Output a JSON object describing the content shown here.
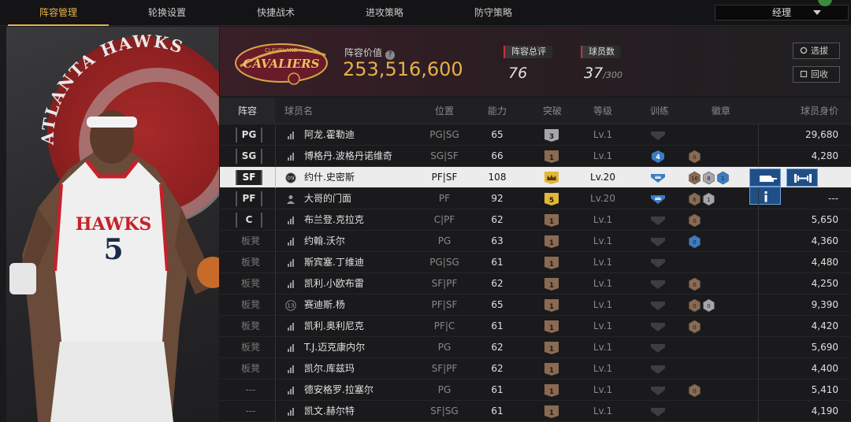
{
  "nav": {
    "tabs": [
      "阵容管理",
      "轮换设置",
      "快捷战术",
      "进攻策略",
      "防守策略"
    ],
    "active_tab": 0,
    "role_select": "经理"
  },
  "poster": {
    "team_word": "ATLANTA HAWKS",
    "jersey_text": "HAWKS",
    "jersey_number": "5"
  },
  "header": {
    "team_logo_text": "CAVALIERS",
    "team_logo_subtext": "CLEVELAND",
    "value_label": "阵容价值",
    "value": "253,516,600",
    "rating_label": "阵容总评",
    "rating": "76",
    "players_label": "球员数",
    "players": "37",
    "players_max": "/300",
    "btn_select": "选拔",
    "btn_recycle": "回收"
  },
  "columns": {
    "lineup": "阵容",
    "name": "球员名",
    "position": "位置",
    "ability": "能力",
    "breakthrough": "突破",
    "level": "等级",
    "training": "训练",
    "badges": "徽章",
    "price": "球员身价"
  },
  "rows": [
    {
      "slot": "PG",
      "slot_type": "starter",
      "name_icon": "bars",
      "name": "阿龙.霍勒迪",
      "position": "PG|SG",
      "ability": "65",
      "breakthrough": "3",
      "breakthrough_type": "silver",
      "level": "Lv.1",
      "training": "none",
      "badges": [],
      "price": "29,680"
    },
    {
      "slot": "SG",
      "slot_type": "starter",
      "name_icon": "bars",
      "name": "博格丹.波格丹诺维奇",
      "position": "SG|SF",
      "ability": "66",
      "breakthrough": "1",
      "breakthrough_type": "bronze",
      "level": "Lv.1",
      "training": "4",
      "badges": [
        {
          "t": "bronze",
          "v": "0"
        }
      ],
      "price": "4,280"
    },
    {
      "slot": "SF",
      "slot_type": "starter",
      "name_icon": "09",
      "name": "约什.史密斯",
      "position": "PF|SF",
      "ability": "108",
      "breakthrough": "crown",
      "breakthrough_type": "gold",
      "level": "Lv.20",
      "training": "crown",
      "badges": [
        {
          "t": "bronze",
          "v": "16"
        },
        {
          "t": "silver",
          "v": "8"
        },
        {
          "t": "blue",
          "v": "1"
        }
      ],
      "price": "",
      "selected": true
    },
    {
      "slot": "PF",
      "slot_type": "starter",
      "name_icon": "person",
      "name": "大哥的门面",
      "position": "PF",
      "ability": "92",
      "breakthrough": "5",
      "breakthrough_type": "gold",
      "level": "Lv.20",
      "training": "crown",
      "badges": [
        {
          "t": "bronze",
          "v": "6"
        },
        {
          "t": "silver",
          "v": "1"
        }
      ],
      "price": "---"
    },
    {
      "slot": "C",
      "slot_type": "starter",
      "name_icon": "bars",
      "name": "布兰登.克拉克",
      "position": "C|PF",
      "ability": "62",
      "breakthrough": "1",
      "breakthrough_type": "bronze",
      "level": "Lv.1",
      "training": "none",
      "badges": [
        {
          "t": "bronze",
          "v": "0"
        }
      ],
      "price": "5,650"
    },
    {
      "slot": "板凳",
      "slot_type": "bench",
      "name_icon": "bars",
      "name": "约翰.沃尔",
      "position": "PG",
      "ability": "63",
      "breakthrough": "1",
      "breakthrough_type": "bronze",
      "level": "Lv.1",
      "training": "none",
      "badges": [
        {
          "t": "blue",
          "v": "0"
        }
      ],
      "price": "4,360"
    },
    {
      "slot": "板凳",
      "slot_type": "bench",
      "name_icon": "bars",
      "name": "斯宾塞.丁维迪",
      "position": "PG|SG",
      "ability": "61",
      "breakthrough": "1",
      "breakthrough_type": "bronze",
      "level": "Lv.1",
      "training": "none",
      "badges": [],
      "price": "4,480"
    },
    {
      "slot": "板凳",
      "slot_type": "bench",
      "name_icon": "bars",
      "name": "凯利.小欧布雷",
      "position": "SF|PF",
      "ability": "62",
      "breakthrough": "1",
      "breakthrough_type": "bronze",
      "level": "Lv.1",
      "training": "none",
      "badges": [
        {
          "t": "bronze",
          "v": "0"
        }
      ],
      "price": "4,250"
    },
    {
      "slot": "板凳",
      "slot_type": "bench",
      "name_icon": "13",
      "name": "赛迪斯.杨",
      "position": "PF|SF",
      "ability": "65",
      "breakthrough": "1",
      "breakthrough_type": "bronze",
      "level": "Lv.1",
      "training": "none",
      "badges": [
        {
          "t": "bronze",
          "v": "0"
        },
        {
          "t": "silver",
          "v": "0"
        }
      ],
      "price": "9,390"
    },
    {
      "slot": "板凳",
      "slot_type": "bench",
      "name_icon": "bars",
      "name": "凯利.奥利尼克",
      "position": "PF|C",
      "ability": "61",
      "breakthrough": "1",
      "breakthrough_type": "bronze",
      "level": "Lv.1",
      "training": "none",
      "badges": [
        {
          "t": "bronze",
          "v": "0"
        }
      ],
      "price": "4,420"
    },
    {
      "slot": "板凳",
      "slot_type": "bench",
      "name_icon": "bars",
      "name": "T.J.迈克康内尔",
      "position": "PG",
      "ability": "62",
      "breakthrough": "1",
      "breakthrough_type": "bronze",
      "level": "Lv.1",
      "training": "none",
      "badges": [],
      "price": "5,690"
    },
    {
      "slot": "板凳",
      "slot_type": "bench",
      "name_icon": "bars",
      "name": "凯尔.库兹玛",
      "position": "SF|PF",
      "ability": "62",
      "breakthrough": "1",
      "breakthrough_type": "bronze",
      "level": "Lv.1",
      "training": "none",
      "badges": [],
      "price": "4,400"
    },
    {
      "slot": "---",
      "slot_type": "none",
      "name_icon": "bars",
      "name": "德安格罗.拉塞尔",
      "position": "PG",
      "ability": "61",
      "breakthrough": "1",
      "breakthrough_type": "bronze",
      "level": "Lv.1",
      "training": "none",
      "badges": [
        {
          "t": "bronze",
          "v": "0"
        }
      ],
      "price": "5,410"
    },
    {
      "slot": "---",
      "slot_type": "none",
      "name_icon": "bars",
      "name": "凯文.赫尔特",
      "position": "SF|SG",
      "ability": "61",
      "breakthrough": "1",
      "breakthrough_type": "bronze",
      "level": "Lv.1",
      "training": "none",
      "badges": [],
      "price": "4,190"
    }
  ],
  "colors": {
    "accent": "#e8b04a",
    "selected_row": "#ececec",
    "action_blue": "#1f4f86"
  },
  "selected_actions": [
    "vehicle-icon",
    "barbell-icon",
    "info-icon"
  ]
}
